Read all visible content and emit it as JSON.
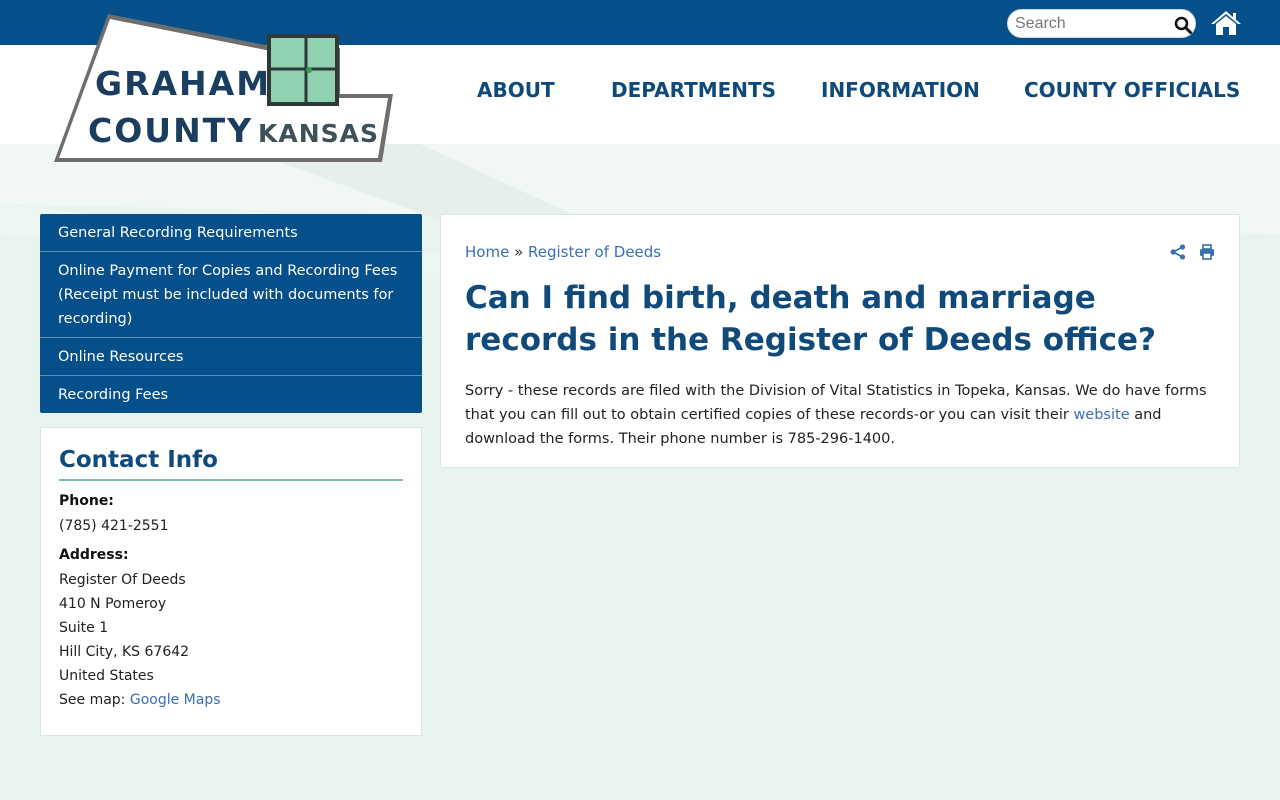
{
  "header": {
    "search_placeholder": "Search",
    "logo": {
      "line1": "GRAHAM",
      "line2": "COUNTY",
      "line3": "KANSAS"
    },
    "nav": [
      "ABOUT",
      "DEPARTMENTS",
      "INFORMATION",
      "COUNTY OFFICIALS"
    ]
  },
  "sidebar": {
    "items": [
      "General Recording Requirements",
      "Online Payment for Copies and Recording Fees (Receipt must be included with documents for recording)",
      "Online Resources",
      "Recording Fees"
    ]
  },
  "contact": {
    "title": "Contact Info",
    "phone_label": "Phone:",
    "phone": "(785) 421-2551",
    "address_label": "Address:",
    "address_lines": [
      "Register Of Deeds",
      "410 N Pomeroy",
      "Suite 1",
      "Hill City, KS 67642",
      "United States"
    ],
    "map_prefix": "See map: ",
    "map_link": "Google Maps"
  },
  "main": {
    "breadcrumb": {
      "home": "Home",
      "sep": " » ",
      "current": "Register of Deeds"
    },
    "title": "Can I find birth, death and marriage records in the Register of Deeds office?",
    "body_before": "Sorry - these records are filed with the Division of Vital Statistics in Topeka, Kansas. We do have forms that you can fill out to obtain certified copies of these records-or you can visit their ",
    "body_link": "website",
    "body_after": " and download the forms. Their phone number is 785-296-1400."
  },
  "colors": {
    "brand_blue": "#054f8a",
    "heading_blue": "#0f4a7b",
    "link_blue": "#3a6fb0",
    "accent_green": "#7dbfa7",
    "background": "#e9f4ee"
  },
  "icons": {
    "search": "search-icon",
    "home": "home-icon",
    "share": "share-icon",
    "print": "print-icon"
  }
}
